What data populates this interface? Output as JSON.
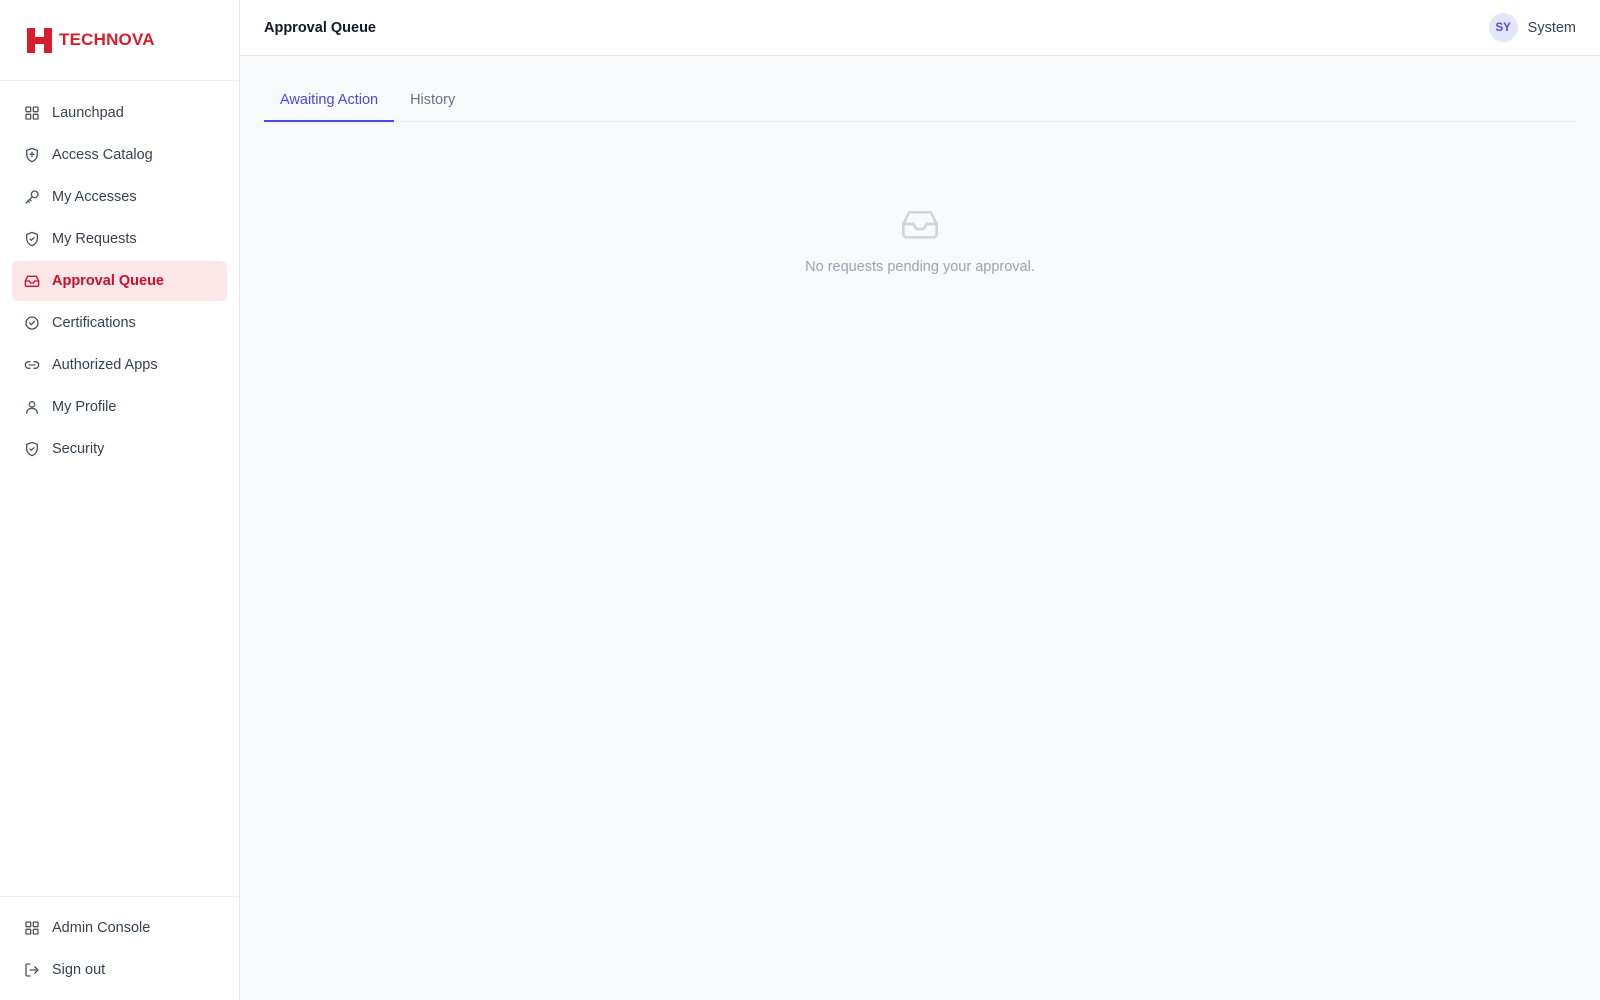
{
  "brand": {
    "name": "TECHNOVA",
    "color": "#d81e2c"
  },
  "sidebar": {
    "items": [
      {
        "label": "Launchpad",
        "icon": "grid-icon"
      },
      {
        "label": "Access Catalog",
        "icon": "shield-plus-icon"
      },
      {
        "label": "My Accesses",
        "icon": "key-icon"
      },
      {
        "label": "My Requests",
        "icon": "shield-check-icon"
      },
      {
        "label": "Approval Queue",
        "icon": "inbox-icon",
        "active": true
      },
      {
        "label": "Certifications",
        "icon": "check-circle-icon"
      },
      {
        "label": "Authorized Apps",
        "icon": "link-icon"
      },
      {
        "label": "My Profile",
        "icon": "user-icon"
      },
      {
        "label": "Security",
        "icon": "shield-check-icon"
      }
    ],
    "bottom_items": [
      {
        "label": "Admin Console",
        "icon": "grid-icon"
      },
      {
        "label": "Sign out",
        "icon": "logout-icon"
      }
    ]
  },
  "header": {
    "title": "Approval Queue",
    "user": {
      "initials": "SY",
      "name": "System"
    }
  },
  "main": {
    "tabs": [
      {
        "label": "Awaiting Action",
        "active": true
      },
      {
        "label": "History",
        "active": false
      }
    ],
    "empty_state": {
      "icon": "inbox-icon",
      "message": "No requests pending your approval."
    }
  },
  "colors": {
    "active_nav_bg": "#fce6e8",
    "active_nav_text": "#c8102e",
    "tab_accent": "#4f46e5"
  }
}
